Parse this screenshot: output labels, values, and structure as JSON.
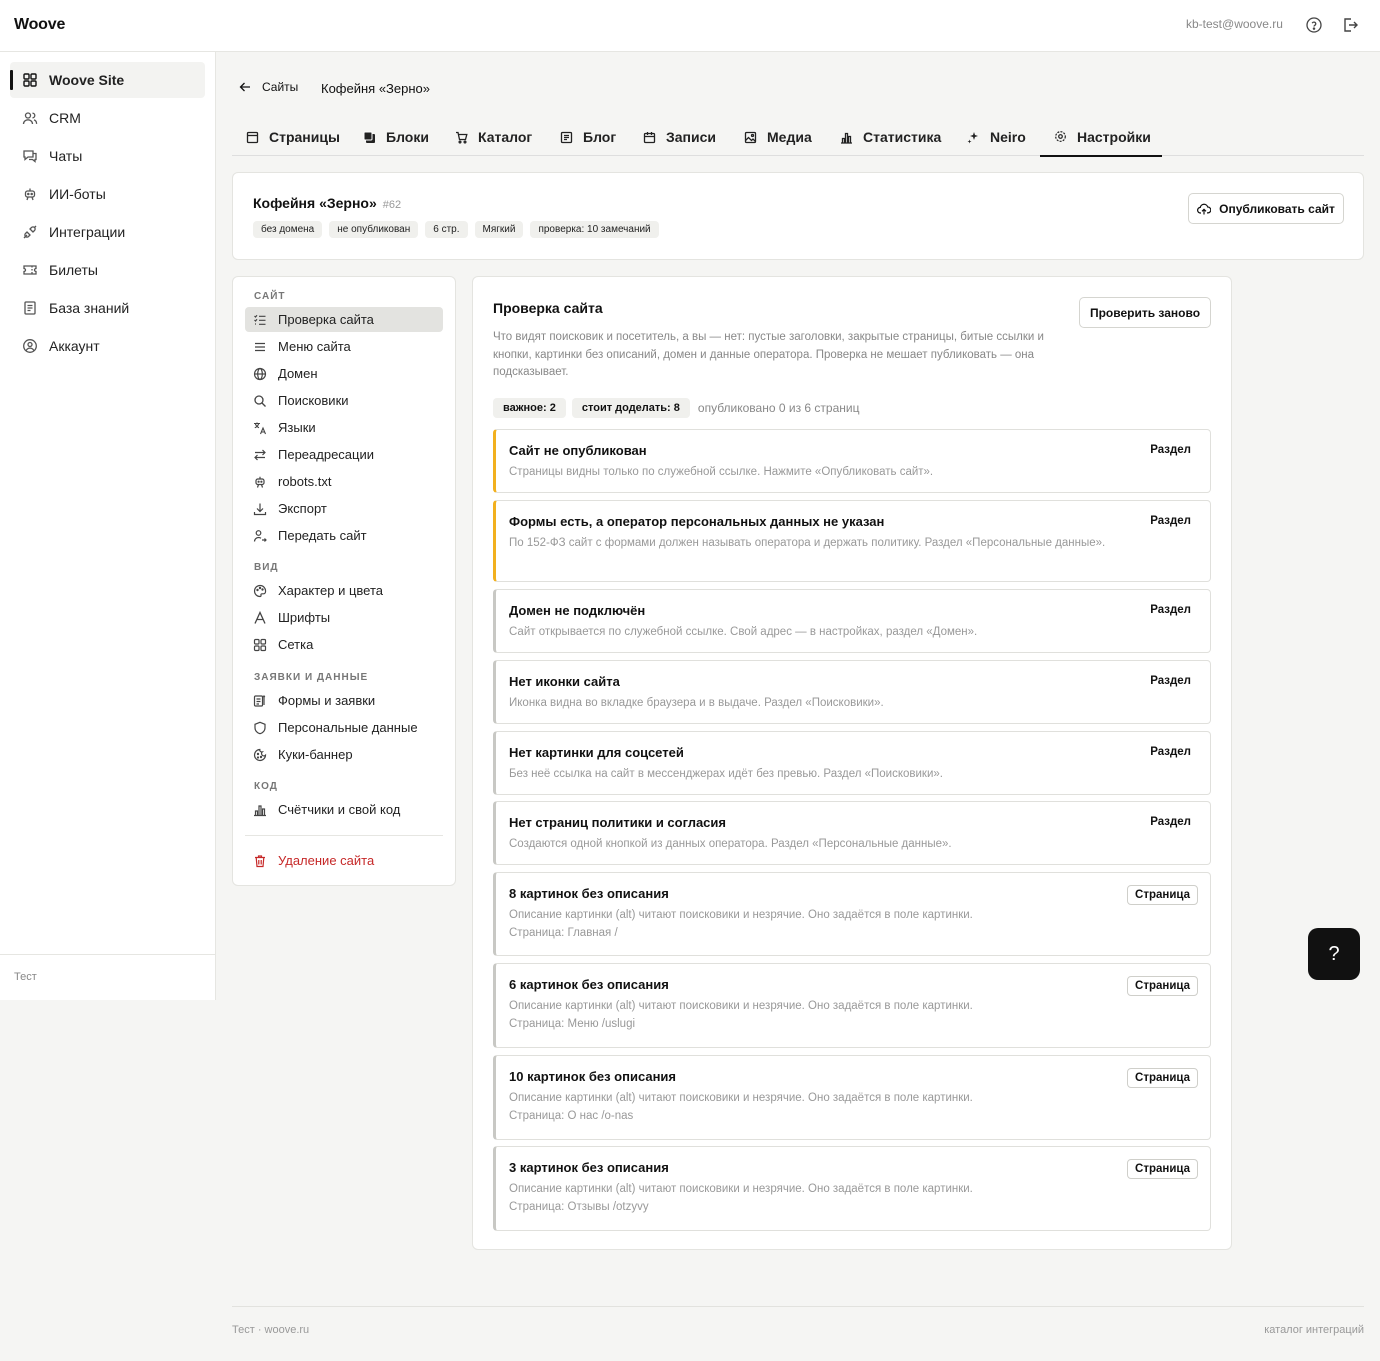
{
  "app": {
    "logo": "Woove",
    "user_email": "kb-test@woove.ru"
  },
  "sidebar": {
    "items": [
      {
        "label": "Woove Site",
        "icon": "grid-icon"
      },
      {
        "label": "CRM",
        "icon": "users-icon"
      },
      {
        "label": "Чаты",
        "icon": "chat-icon"
      },
      {
        "label": "ИИ-боты",
        "icon": "bot-icon"
      },
      {
        "label": "Интеграции",
        "icon": "plug-icon"
      },
      {
        "label": "Билеты",
        "icon": "ticket-icon"
      },
      {
        "label": "База знаний",
        "icon": "book-icon"
      },
      {
        "label": "Аккаунт",
        "icon": "user-circle-icon"
      }
    ],
    "footer": "Тест"
  },
  "breadcrumb": {
    "back": "Сайты",
    "title": "Кофейня «Зерно»"
  },
  "tabs": [
    {
      "label": "Страницы"
    },
    {
      "label": "Блоки"
    },
    {
      "label": "Каталог"
    },
    {
      "label": "Блог"
    },
    {
      "label": "Записи"
    },
    {
      "label": "Медиа"
    },
    {
      "label": "Статистика"
    },
    {
      "label": "Neiro"
    },
    {
      "label": "Настройки"
    }
  ],
  "site": {
    "name": "Кофейня «Зерно»",
    "id": "#62",
    "badges": [
      "без домена",
      "не опубликован",
      "6 стр.",
      "Мягкий",
      "проверка: 10 замечаний"
    ],
    "publish_label": "Опубликовать сайт"
  },
  "settings_menu": {
    "sections": [
      {
        "label": "САЙТ",
        "items": [
          "Проверка сайта",
          "Меню сайта",
          "Домен",
          "Поисковики",
          "Языки",
          "Переадресации",
          "robots.txt",
          "Экспорт",
          "Передать сайт"
        ]
      },
      {
        "label": "ВИД",
        "items": [
          "Характер и цвета",
          "Шрифты",
          "Сетка"
        ]
      },
      {
        "label": "ЗАЯВКИ И ДАННЫЕ",
        "items": [
          "Формы и заявки",
          "Персональные данные",
          "Куки-баннер"
        ]
      },
      {
        "label": "КОД",
        "items": [
          "Счётчики и свой код"
        ]
      }
    ],
    "delete_label": "Удаление сайта"
  },
  "check": {
    "title": "Проверка сайта",
    "description": "Что видят поисковик и посетитель, а вы — нет: пустые заголовки, закрытые страницы, битые ссылки и кнопки, картинки без описаний, домен и данные оператора. Проверка не мешает публиковать — она подсказывает.",
    "recheck_label": "Проверить заново",
    "pill_important": "важное: 2",
    "pill_todo": "стоит доделать: 8",
    "summary": "опубликовано 0 из 6 страниц",
    "issues": [
      {
        "title": "Сайт не опубликован",
        "desc": "Страницы видны только по служебной ссылке. Нажмите «Опубликовать сайт».",
        "link": "Раздел",
        "severity": "important"
      },
      {
        "title": "Формы есть, а оператор персональных данных не указан",
        "desc": "По 152-ФЗ сайт с формами должен называть оператора и держать политику. Раздел «Персональные данные».",
        "link": "Раздел",
        "severity": "important"
      },
      {
        "title": "Домен не подключён",
        "desc": "Сайт открывается по служебной ссылке. Свой адрес — в настройках, раздел «Домен».",
        "link": "Раздел",
        "severity": "todo"
      },
      {
        "title": "Нет иконки сайта",
        "desc": "Иконка видна во вкладке браузера и в выдаче. Раздел «Поисковики».",
        "link": "Раздел",
        "severity": "todo"
      },
      {
        "title": "Нет картинки для соцсетей",
        "desc": "Без неё ссылка на сайт в мессенджерах идёт без превью. Раздел «Поисковики».",
        "link": "Раздел",
        "severity": "todo"
      },
      {
        "title": "Нет страниц политики и согласия",
        "desc": "Создаются одной кнопкой из данных оператора. Раздел «Персональные данные».",
        "link": "Раздел",
        "severity": "todo"
      },
      {
        "title": "8 картинок без описания",
        "desc": "Описание картинки (alt) читают поисковики и незрячие. Оно задаётся в поле картинки.",
        "page": "Страница: Главная /",
        "link": "Страница",
        "severity": "todo"
      },
      {
        "title": "6 картинок без описания",
        "desc": "Описание картинки (alt) читают поисковики и незрячие. Оно задаётся в поле картинки.",
        "page": "Страница: Меню /uslugi",
        "link": "Страница",
        "severity": "todo"
      },
      {
        "title": "10 картинок без описания",
        "desc": "Описание картинки (alt) читают поисковики и незрячие. Оно задаётся в поле картинки.",
        "page": "Страница: О нас /o-nas",
        "link": "Страница",
        "severity": "todo"
      },
      {
        "title": "3 картинок без описания",
        "desc": "Описание картинки (alt) читают поисковики и незрячие. Оно задаётся в поле картинки.",
        "page": "Страница: Отзывы /otzyvy",
        "link": "Страница",
        "severity": "todo"
      }
    ]
  },
  "help_fab": "?",
  "footer": {
    "left": "Тест · woove.ru",
    "right": "каталог интеграций"
  },
  "colors": {
    "accent": "#111111",
    "warning": "#f2b01e",
    "danger": "#c62828"
  }
}
